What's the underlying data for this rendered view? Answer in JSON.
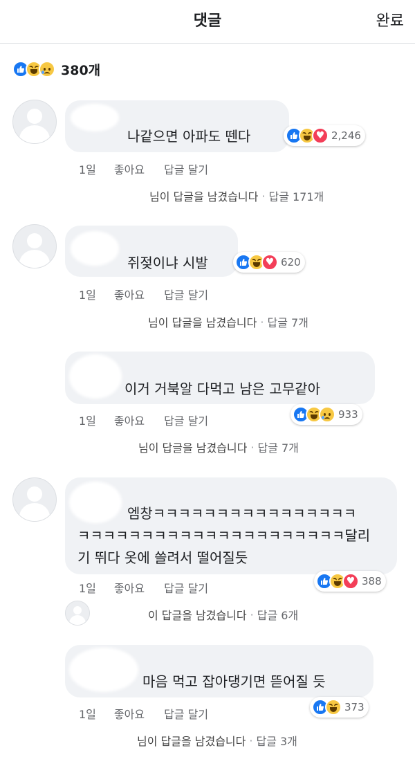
{
  "header": {
    "title": "댓글",
    "done_label": "완료"
  },
  "summary": {
    "reactions": [
      "like-icon",
      "haha-icon",
      "sad-icon"
    ],
    "count": "380개"
  },
  "comments": [
    {
      "text": "나같으면 아파도 뗀다",
      "reactions": [
        "like",
        "haha",
        "love"
      ],
      "reaction_count": "2,246",
      "time": "1일",
      "like_label": "좋아요",
      "reply_label": "답글 달기",
      "reply_text": "님이 답글을 남겼습니다",
      "reply_count": "답글 171개"
    },
    {
      "text": "쥐젖이냐 시발",
      "reactions": [
        "like",
        "haha",
        "love"
      ],
      "reaction_count": "620",
      "time": "1일",
      "like_label": "좋아요",
      "reply_label": "답글 달기",
      "reply_text": "님이 답글을 남겼습니다",
      "reply_count": "답글 7개"
    },
    {
      "text": "이거 거북알 다먹고 남은 고무같아",
      "reactions": [
        "like",
        "haha",
        "sad"
      ],
      "reaction_count": "933",
      "time": "1일",
      "like_label": "좋아요",
      "reply_label": "답글 달기",
      "reply_text": "님이 답글을 남겼습니다",
      "reply_count": "답글 7개"
    },
    {
      "text_line1": "엠창ㅋㅋㅋㅋㅋㅋㅋㅋㅋㅋㅋㅋㅋㅋㅋㅋ",
      "text_line2": "ㅋㅋㅋㅋㅋㅋㅋㅋㅋㅋㅋㅋㅋㅋㅋㅋㅋㅋㅋㅋㅋ달리",
      "text_line3": "기 뛰다 옷에 쓸려서 떨어질듯",
      "reactions": [
        "like",
        "haha",
        "love"
      ],
      "reaction_count": "388",
      "time": "1일",
      "like_label": "좋아요",
      "reply_label": "답글 달기",
      "reply_text": "이 답글을 남겼습니다",
      "reply_count": "답글 6개"
    },
    {
      "text": "마음 먹고 잡아댕기면 뜯어질 듯",
      "reactions": [
        "like",
        "haha"
      ],
      "reaction_count": "373",
      "time": "1일",
      "like_label": "좋아요",
      "reply_label": "답글 달기",
      "reply_text": "님이 답글을 남겼습니다",
      "reply_count": "답글 3개"
    }
  ],
  "colors": {
    "like": "#1877f2",
    "haha": "#f7c843",
    "love": "#f33e58",
    "bubble": "#f0f2f5",
    "meta": "#65676b"
  }
}
